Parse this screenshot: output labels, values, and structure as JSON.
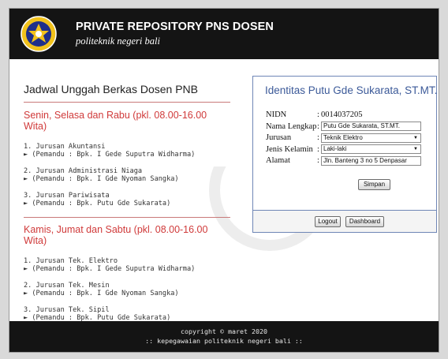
{
  "header": {
    "title": "PRIVATE REPOSITORY PNS DOSEN",
    "subtitle": "politeknik negeri bali"
  },
  "schedule": {
    "title": "Jadwal Unggah Berkas Dosen PNB",
    "groups": [
      {
        "title": "Senin, Selasa dan Rabu (pkl. 08.00-16.00 Wita)",
        "items": [
          {
            "name": "1. Jurusan Akuntansi",
            "guide": "► (Pemandu : Bpk. I Gede Suputra Widharma)"
          },
          {
            "name": "2. Jurusan Administrasi Niaga",
            "guide": "► (Pemandu : Bpk. I Gde Nyoman Sangka)"
          },
          {
            "name": "3. Jurusan Pariwisata",
            "guide": "► (Pemandu : Bpk. Putu Gde Sukarata)"
          }
        ]
      },
      {
        "title": "Kamis, Jumat dan Sabtu (pkl. 08.00-16.00 Wita)",
        "items": [
          {
            "name": "1. Jurusan Tek. Elektro",
            "guide": "► (Pemandu : Bpk. I Gede Suputra Widharma)"
          },
          {
            "name": "2. Jurusan Tek. Mesin",
            "guide": "► (Pemandu : Bpk. I Gde Nyoman Sangka)"
          },
          {
            "name": "3. Jurusan Tek. Sipil",
            "guide": "► (Pemandu : Bpk. Putu Gde Sukarata)"
          }
        ]
      }
    ]
  },
  "identity": {
    "title": "Identitas Putu Gde Sukarata, ST.MT.",
    "nidn_label": "NIDN",
    "nidn_value": "0014037205",
    "name_label": "Nama Lengkap",
    "name_value": "Putu Gde Sukarata, ST.MT.",
    "dept_label": "Jurusan",
    "dept_value": "Teknik Elektro",
    "gender_label": "Jenis Kelamin",
    "gender_value": "Laki-laki",
    "address_label": "Alamat",
    "address_value": "Jln. Banteng 3 no 5 Denpasar",
    "colon": ":",
    "save_label": "Simpan",
    "logout_label": "Logout",
    "dashboard_label": "Dashboard"
  },
  "footer": {
    "copyright": "copyright © maret 2020",
    "line2": ":: kepegawaian politeknik negeri bali ::"
  },
  "colors": {
    "header_bg": "#141414",
    "accent_red": "#d03a3a",
    "card_border": "#6f86b6",
    "card_title": "#3c5a99"
  }
}
